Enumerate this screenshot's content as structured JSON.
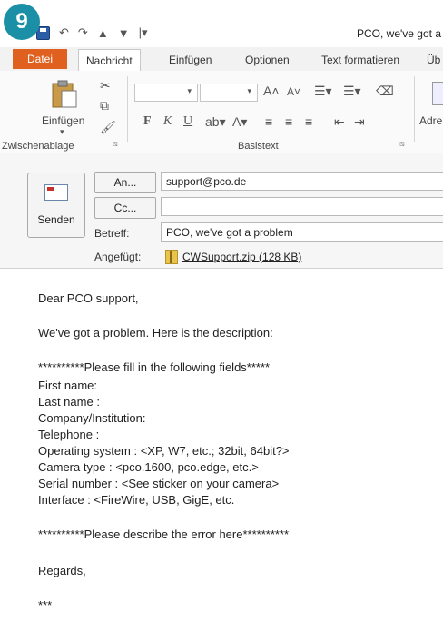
{
  "step_badge": "9",
  "window": {
    "title": "PCO, we've got a"
  },
  "ribbon_tabs": [
    "Datei",
    "Nachricht",
    "Einfügen",
    "Optionen",
    "Text formatieren",
    "Üb"
  ],
  "ribbon": {
    "paste_label": "Einfügen",
    "group_clipboard": "Zwischenablage",
    "group_basic_text": "Basistext",
    "bold": "F",
    "italic": "K",
    "underline": "U",
    "address_truncated": "Adre"
  },
  "header": {
    "send_label": "Senden",
    "to_button": "An...",
    "cc_button": "Cc...",
    "subject_label": "Betreff:",
    "attached_label": "Angefügt:",
    "to_value": "support@pco.de",
    "cc_value": "",
    "subject_value": "PCO, we've got a problem",
    "attachment": "CWSupport.zip (128 KB)"
  },
  "body": {
    "greeting": "Dear PCO support,",
    "intro": "We've got a problem. Here is the description:",
    "fill_header": "**********Please fill in the following fields*****",
    "fields": [
      "First name:",
      "Last name :",
      "Company/Institution:",
      "Telephone :",
      "Operating system : <XP, W7, etc.; 32bit, 64bit?>",
      "Camera type : <pco.1600, pco.edge, etc.>",
      "Serial number : <See sticker on your camera>",
      "Interface : <FireWire, USB, GigE, etc."
    ],
    "error_header": "**********Please describe the error here**********",
    "regards": "Regards,",
    "signature": "***"
  },
  "colors": {
    "file_tab": "#e0611f",
    "badge": "#1b8fa6"
  }
}
